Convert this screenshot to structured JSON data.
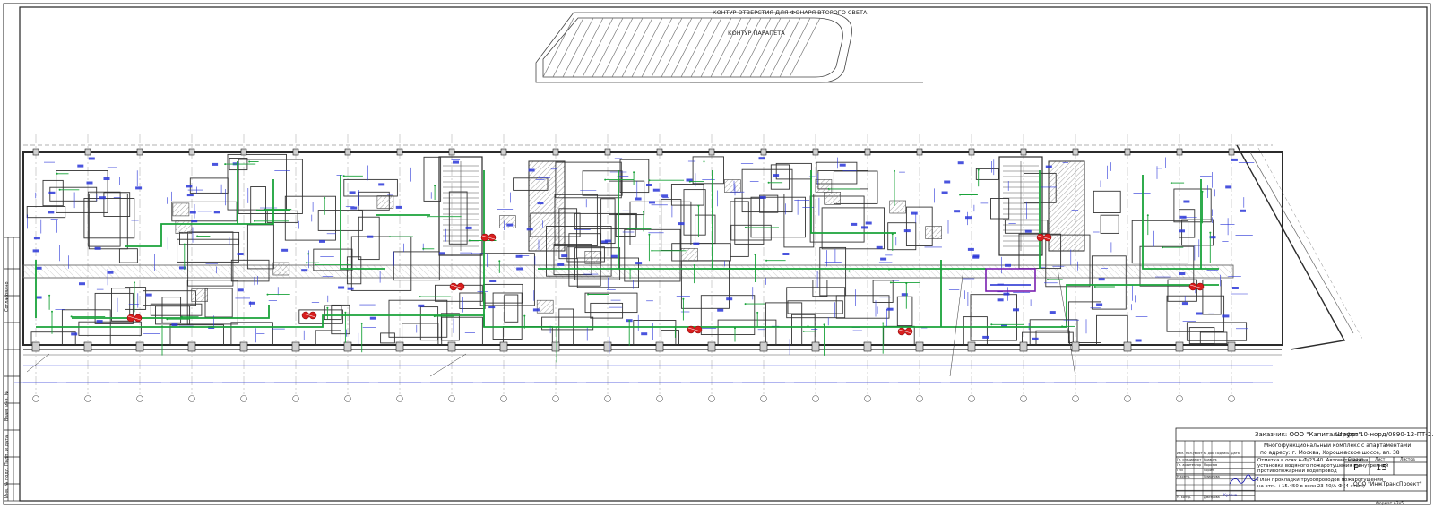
{
  "annotations": {
    "skylight": "КОНТУР ОТВЕРСТИЯ ДЛЯ ФОНАРЯ ВТОРОГО СВЕТА",
    "parapet": "КОНТУР ПАРАПЕТА"
  },
  "title_block": {
    "customer": "Заказчик: ООО \"Капитал-групп\"",
    "code": "Шифр: 10-норд/0890-12-ПТ-2.2",
    "object_line1": "Многофункциональный комплекс с апартаментами",
    "object_line2": "по адресу: г. Москва, Хорошевское шоссе, вл. 38",
    "section_line1": "Отметка в осях А-Ф/23-40. Автоматическая",
    "section_line2": "установка водяного пожаротушения и внутренний",
    "section_line3": "противопожарный водопровод",
    "sheet_line1": "План прокладки трубопроводов пожаротушения",
    "sheet_line2": "на отм. +15.450 в осях 23-40/А-Ф (4 этаж)",
    "stage_head": "Стадия",
    "sheet_head": "Лист",
    "sheets_head": "Листов",
    "stage": "Р",
    "sheet_no": "15",
    "company": "ООО \"ИнжТрансПроект\"",
    "format": "Формат А3х5",
    "signature": "Кулика",
    "table_header": [
      "Изм.",
      "Кол.уч",
      "Лист",
      "№ док.",
      "Подпись",
      "Дата"
    ],
    "roles": [
      "Гл. специалист",
      "Гл. архитектор",
      "ГИП",
      "Н.контр."
    ],
    "names": [
      "Кравчук",
      "Морозов",
      "Сорин",
      "Смирнова"
    ],
    "bottom_role": "Н. контр.",
    "bottom_name": "Дмитрова"
  },
  "side_stamp": {
    "agreed": "Согласовано",
    "inv": "Инв. № подл.",
    "sign_date": "Подп. и дата",
    "replace": "Взам. инв. №"
  },
  "colors": {
    "pipe": "#1aa33a",
    "dim": "#2a36d8",
    "wall": "#2b2b2b",
    "grid": "#7a7a7a",
    "hatch": "#9a9a9a",
    "equip": "#d81e1e",
    "pump": "#7a1fb0"
  }
}
